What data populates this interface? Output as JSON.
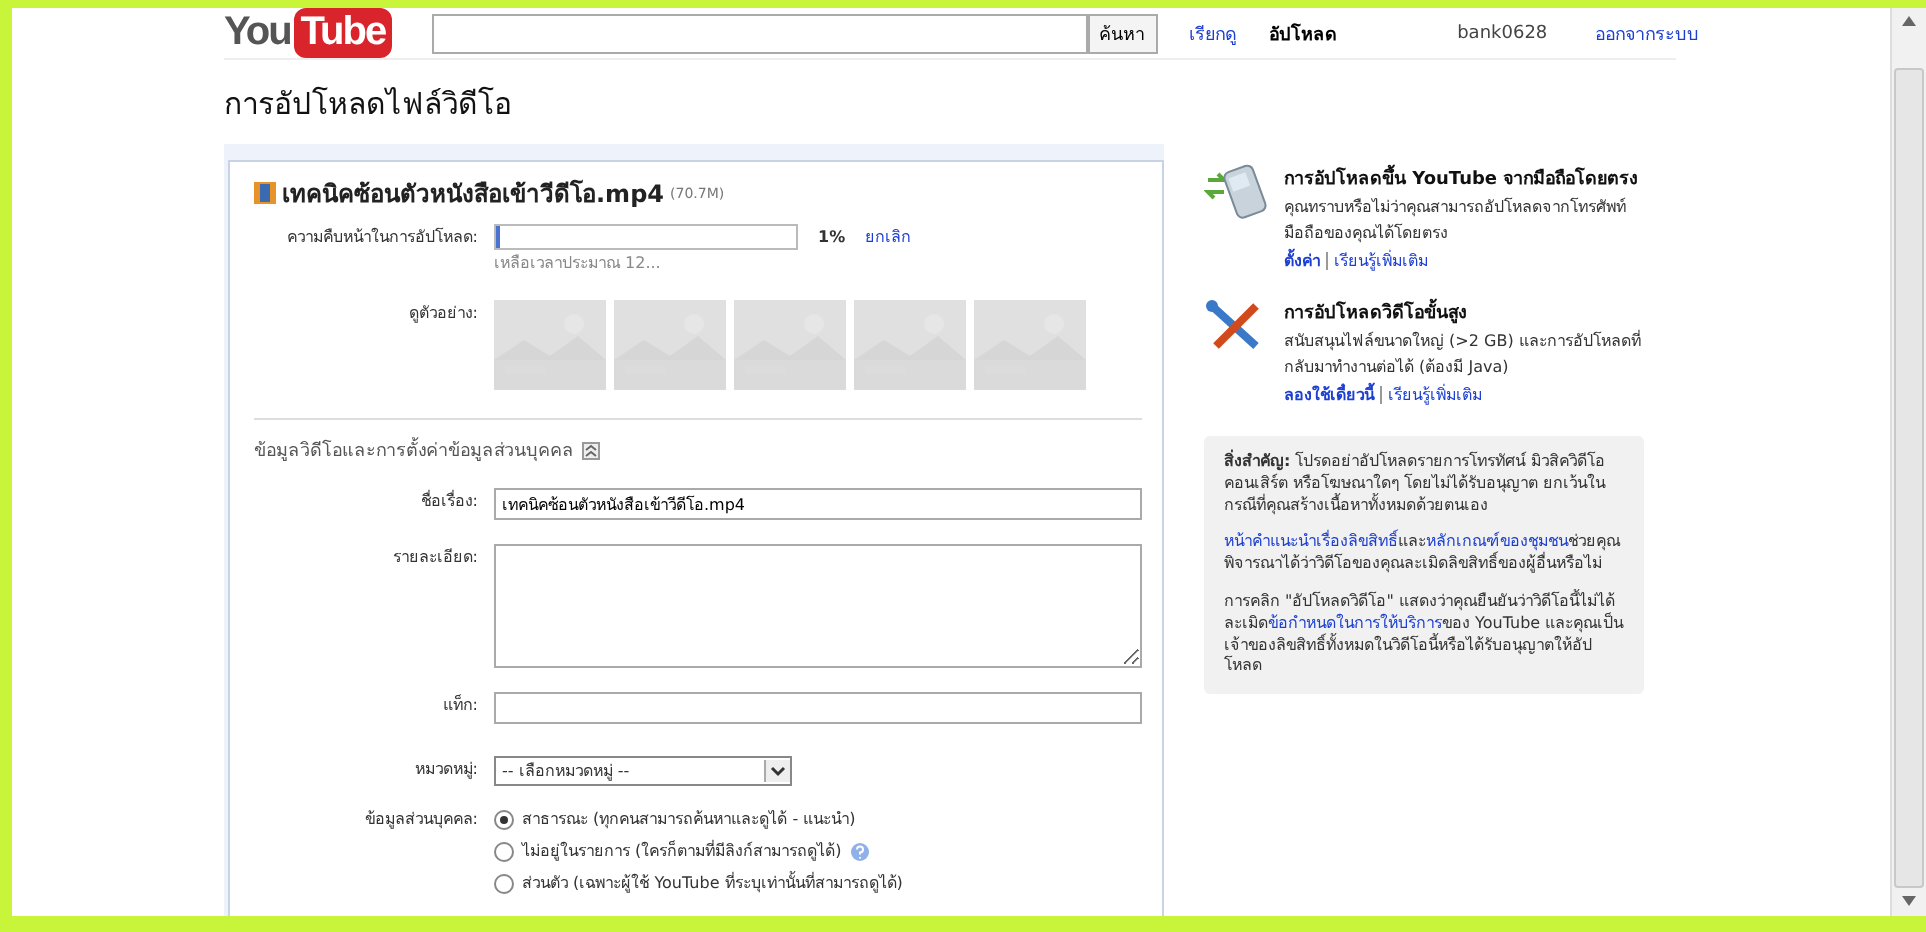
{
  "header": {
    "logo": {
      "left": "You",
      "right": "Tube"
    },
    "search": {
      "button": "ค้นหา"
    },
    "nav": [
      {
        "label": "เรียกดู",
        "selected": false
      },
      {
        "label": "อัปโหลด",
        "selected": true
      }
    ],
    "user": "bank0628",
    "signout": "ออกจากระบบ"
  },
  "page_title": "การอัปโหลดไฟล์วิดีโอ",
  "upload": {
    "filename": "เทคนิคซ้อนตัวหนังสือเข้าวีดีโอ.mp4",
    "size": "(70.7M)",
    "progress": {
      "label": "ความคืบหน้าในการอัปโหลด:",
      "level": 0.01,
      "percent": "1%",
      "cancel": "ยกเลิก",
      "remaining": "เหลือเวลาประมาณ 12..."
    },
    "preview": {
      "label": "ดูตัวอย่าง:"
    }
  },
  "details": {
    "heading": "ข้อมูลวิดีโอและการตั้งค่าข้อมูลส่วนบุคคล",
    "expanded": true,
    "fields": [
      {
        "kind": "text",
        "label": "ชื่อเรื่อง:",
        "value": "เทคนิคซ้อนตัวหนังสือเข้าวีดีโอ.mp4"
      },
      {
        "kind": "textarea",
        "label": "รายละเอียด:"
      },
      {
        "kind": "text",
        "label": "แท็ก:"
      },
      {
        "kind": "select",
        "label": "หมวดหมู่:",
        "value": "-- เลือกหมวดหมู่ --"
      }
    ],
    "privacy": {
      "label": "ข้อมูลส่วนบุคคล:",
      "options": [
        {
          "label": "สาธารณะ (ทุกคนสามารถค้นหาและดูได้ - แนะนำ)",
          "selected": true,
          "help": false
        },
        {
          "label": "ไม่อยู่ในรายการ (ใครก็ตามที่มีลิงก์สามารถดูได้)",
          "selected": false,
          "help": true
        },
        {
          "label": "ส่วนตัว (เฉพาะผู้ใช้ YouTube ที่ระบุเท่านั้นที่สามารถดูได้)",
          "selected": false,
          "help": false
        }
      ]
    }
  },
  "sidebar": {
    "promos": [
      {
        "kind": "phone",
        "title": "การอัปโหลดขึ้น YouTube จากมือถือโดยตรง",
        "text": "คุณทราบหรือไม่ว่าคุณสามารถอัปโหลดจากโทรศัพท์มือถือของคุณได้โดยตรง",
        "links": [
          "ตั้งค่า",
          "เรียนรู้เพิ่มเติม"
        ]
      },
      {
        "kind": "tools",
        "title": "การอัปโหลดวิดีโอขั้นสูง",
        "text": "สนับสนุนไฟล์ขนาดใหญ่ (>2 GB) และการอัปโหลดที่กลับมาทำงานต่อได้ (ต้องมี Java)",
        "links": [
          "ลองใช้เดี๋ยวนี้",
          "เรียนรู้เพิ่มเติม"
        ]
      }
    ],
    "notice": [
      [
        {
          "text": "**สิ่งสำคัญ:** โปรดอย่าอัปโหลดรายการโทรทัศน์ มิวสิควิดีโอ คอนเสิร์ต หรือโฆษณาใดๆ โดยไม่ได้รับอนุญาต ยกเว้นในกรณีที่คุณสร้างเนื้อหาทั้งหมดด้วยตนเอง",
          "link": false
        }
      ],
      [
        {
          "text": "หน้าคำแนะนำเรื่องลิขสิทธิ์",
          "link": true
        },
        {
          "text": "และ",
          "link": false
        },
        {
          "text": "หลักเกณฑ์ของชุมชน",
          "link": true
        },
        {
          "text": "ช่วยคุณพิจารณาได้ว่าวิดีโอของคุณละเมิดลิขสิทธิ์ของผู้อื่นหรือไม่",
          "link": false
        }
      ],
      [
        {
          "text": "การคลิก \"อัปโหลดวิดีโอ\" แสดงว่าคุณยืนยันว่าวิดีโอนี้ไม่ได้ละเมิด",
          "link": false
        },
        {
          "text": "ข้อกำหนดในการให้บริการ",
          "link": true
        },
        {
          "text": "ของ YouTube และคุณเป็นเจ้าของลิขสิทธิ์ทั้งหมดในวิดีโอนี้หรือได้รับอนุญาตให้อัปโหลด",
          "link": false
        }
      ]
    ]
  }
}
